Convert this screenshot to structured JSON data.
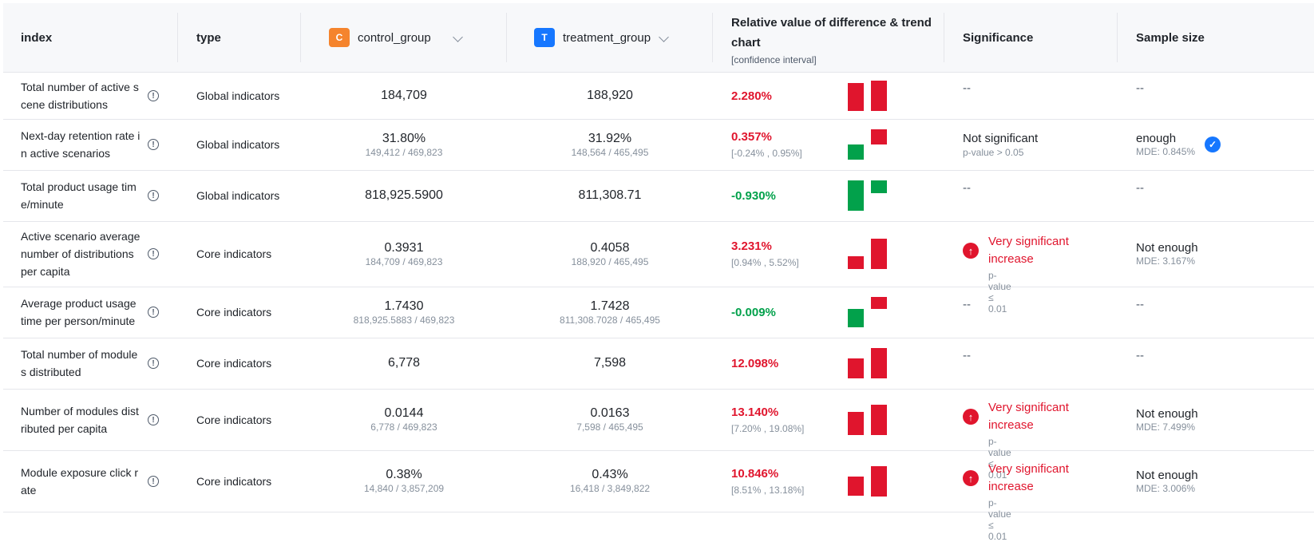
{
  "header": {
    "index": "index",
    "type": "type",
    "control": {
      "badge": "C",
      "name": "control_group",
      "color": "#f5842d"
    },
    "treatment": {
      "badge": "T",
      "name": "treatment_group",
      "color": "#1677ff"
    },
    "relative_title": "Relative value of difference & trend chart",
    "relative_sub": "[confidence interval]",
    "significance": "Significance",
    "sample_size": "Sample size"
  },
  "colors": {
    "positive": "#e0152d",
    "negative": "#02a14b",
    "check": "#1677ff"
  },
  "rows": [
    {
      "index": "Total number of active scene distributions",
      "type": "Global indicators",
      "control": {
        "main": "184,709",
        "sub": ""
      },
      "treatment": {
        "main": "188,920",
        "sub": ""
      },
      "relative": {
        "pct": "2.280%",
        "ci": "",
        "dir": "pos"
      },
      "trend": {
        "control": 0.011,
        "treatment": 0.012
      },
      "significance": {
        "kind": "dash",
        "text": "--",
        "pvalue": ""
      },
      "sample": {
        "text": "--",
        "mde": "",
        "check": false
      }
    },
    {
      "index": "Next-day retention rate in active scenarios",
      "type": "Global indicators",
      "control": {
        "main": "31.80%",
        "sub": "149,412 / 469,823"
      },
      "treatment": {
        "main": "31.92%",
        "sub": "148,564 / 465,495"
      },
      "relative": {
        "pct": "0.357%",
        "ci": "[-0.24% , 0.95%]",
        "dir": "pos"
      },
      "trend": {
        "control": -0.004,
        "treatment": 0.004
      },
      "significance": {
        "kind": "normal",
        "text": "Not significant",
        "pvalue": "p-value > 0.05"
      },
      "sample": {
        "text": "enough",
        "mde": "MDE: 0.845%",
        "check": true
      }
    },
    {
      "index": "Total product usage time/minute",
      "type": "Global indicators",
      "control": {
        "main": "818,925.5900",
        "sub": ""
      },
      "treatment": {
        "main": "811,308.71",
        "sub": ""
      },
      "relative": {
        "pct": "-0.930%",
        "ci": "",
        "dir": "neg"
      },
      "trend": {
        "control": -0.012,
        "treatment": -0.005
      },
      "significance": {
        "kind": "dash",
        "text": "--",
        "pvalue": ""
      },
      "sample": {
        "text": "--",
        "mde": "",
        "check": false
      }
    },
    {
      "index": "Active scenario average number of distributions per capita",
      "type": "Core indicators",
      "control": {
        "main": "0.3931",
        "sub": "184,709 / 469,823"
      },
      "treatment": {
        "main": "0.4058",
        "sub": "188,920 / 465,495"
      },
      "relative": {
        "pct": "3.231%",
        "ci": "[0.94% , 5.52%]",
        "dir": "pos"
      },
      "trend": {
        "control": 0.005,
        "treatment": 0.012
      },
      "significance": {
        "kind": "big",
        "text": "Very significant increase",
        "pvalue": "p-value ≤ 0.01"
      },
      "sample": {
        "text": "Not enough",
        "mde": "MDE: 3.167%",
        "check": false
      }
    },
    {
      "index": "Average product usage time per person/minute",
      "type": "Core indicators",
      "control": {
        "main": "1.7430",
        "sub": "818,925.5883 / 469,823"
      },
      "treatment": {
        "main": "1.7428",
        "sub": "811,308.7028 / 465,495"
      },
      "relative": {
        "pct": "-0.009%",
        "ci": "",
        "dir": "neg"
      },
      "trend": {
        "control": -0.006,
        "treatment": 0.004
      },
      "significance": {
        "kind": "dash",
        "text": "--",
        "pvalue": ""
      },
      "sample": {
        "text": "--",
        "mde": "",
        "check": false
      }
    },
    {
      "index": "Total number of modules distributed",
      "type": "Core indicators",
      "control": {
        "main": "6,778",
        "sub": ""
      },
      "treatment": {
        "main": "7,598",
        "sub": ""
      },
      "relative": {
        "pct": "12.098%",
        "ci": "",
        "dir": "pos"
      },
      "trend": {
        "control": 0.008,
        "treatment": 0.012
      },
      "significance": {
        "kind": "dash",
        "text": "--",
        "pvalue": ""
      },
      "sample": {
        "text": "--",
        "mde": "",
        "check": false
      }
    },
    {
      "index": "Number of modules distributed per capita",
      "type": "Core indicators",
      "control": {
        "main": "0.0144",
        "sub": "6,778 / 469,823"
      },
      "treatment": {
        "main": "0.0163",
        "sub": "7,598 / 465,495"
      },
      "relative": {
        "pct": "13.140%",
        "ci": "[7.20% , 19.08%]",
        "dir": "pos"
      },
      "trend": {
        "control": 0.009,
        "treatment": 0.012
      },
      "significance": {
        "kind": "big",
        "text": "Very significant increase",
        "pvalue": "p-value ≤ 0.01"
      },
      "sample": {
        "text": "Not enough",
        "mde": "MDE: 7.499%",
        "check": false
      }
    },
    {
      "index": "Module exposure click rate",
      "type": "Core indicators",
      "control": {
        "main": "0.38%",
        "sub": "14,840 / 3,857,209"
      },
      "treatment": {
        "main": "0.43%",
        "sub": "16,418 / 3,849,822"
      },
      "relative": {
        "pct": "10.846%",
        "ci": "[8.51% , 13.18%]",
        "dir": "pos"
      },
      "trend": {
        "control": 0.007,
        "treatment": 0.011
      },
      "significance": {
        "kind": "big",
        "text": "Very significant increase",
        "pvalue": "p-value ≤ 0.01"
      },
      "sample": {
        "text": "Not enough",
        "mde": "MDE: 3.006%",
        "check": false
      }
    }
  ]
}
